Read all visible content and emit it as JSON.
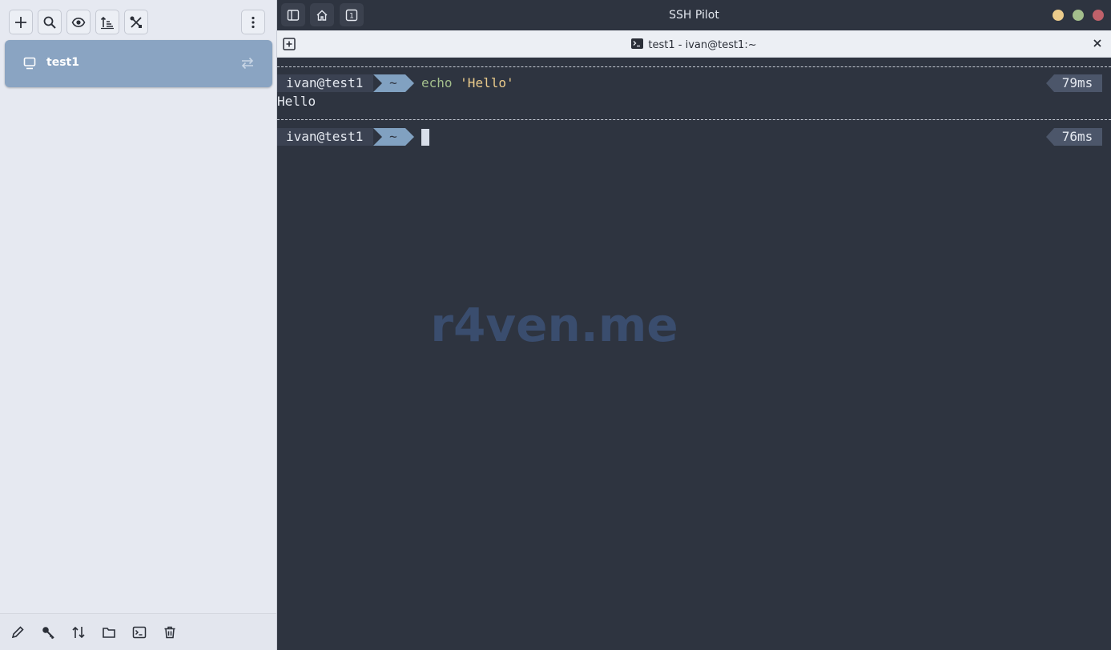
{
  "app": {
    "title": "SSH Pilot"
  },
  "sidebar": {
    "toolbar": [
      {
        "name": "add-host-button",
        "icon": "plus-icon"
      },
      {
        "name": "search-button",
        "icon": "search-icon"
      },
      {
        "name": "visibility-button",
        "icon": "eye-icon"
      },
      {
        "name": "sort-button",
        "icon": "sort-icon"
      },
      {
        "name": "tools-button",
        "icon": "tools-icon"
      },
      {
        "name": "menu-button",
        "icon": "kebab-menu-icon"
      }
    ],
    "hosts": [
      {
        "name": "test1",
        "icon": "monitor-icon",
        "status_icon": "sync-arrows-icon"
      }
    ],
    "footer": [
      {
        "name": "edit-button",
        "icon": "pencil-icon"
      },
      {
        "name": "keys-button",
        "icon": "key-icon"
      },
      {
        "name": "transfer-button",
        "icon": "up-down-arrows-icon"
      },
      {
        "name": "files-button",
        "icon": "folder-icon"
      },
      {
        "name": "terminal-button",
        "icon": "terminal-icon"
      },
      {
        "name": "delete-button",
        "icon": "trash-icon"
      }
    ]
  },
  "header": {
    "buttons": [
      {
        "name": "toggle-sidebar-button",
        "icon": "sidebar-icon"
      },
      {
        "name": "home-button",
        "icon": "home-icon"
      },
      {
        "name": "tab-overview-button",
        "icon": "tab-count-icon",
        "label": "1"
      }
    ]
  },
  "tab": {
    "title": "test1 - ivan@test1:~",
    "icon": "terminal-icon"
  },
  "terminal": {
    "prompt1": {
      "user": "ivan@test1",
      "dir": "~",
      "command": "echo",
      "arg": "'Hello'",
      "timing": "79ms"
    },
    "output1": "Hello",
    "prompt2": {
      "user": "ivan@test1",
      "dir": "~",
      "timing": "76ms"
    },
    "watermark": "r4ven.me"
  },
  "colors": {
    "sidebar_bg": "#e6e9f1",
    "host_selected": "#8aa4c2",
    "terminal_bg": "#2e3440",
    "prompt_user_bg": "#3b4252",
    "prompt_dir_bg": "#81a1c1",
    "command": "#a3be8c",
    "string": "#ebcb8b",
    "timing_bg": "#4c566a",
    "window_minimize": "#ebcb8b",
    "window_maximize": "#a3be8c",
    "window_close": "#bf616a"
  }
}
